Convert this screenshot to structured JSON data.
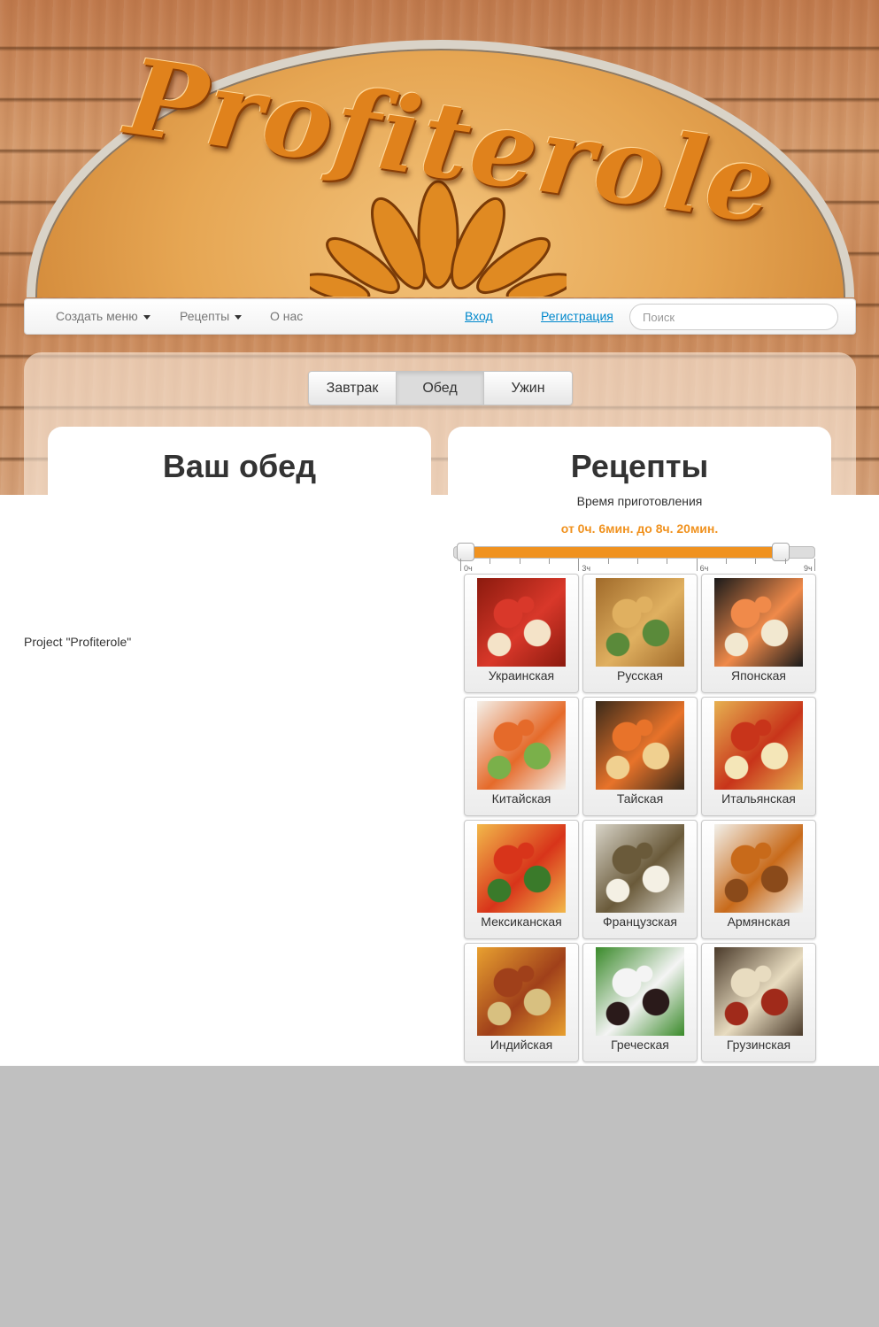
{
  "logo": {
    "text": "Profiterole"
  },
  "nav": {
    "create_menu": "Создать меню",
    "recipes": "Рецепты",
    "about": "О нас",
    "login": "Вход",
    "register": "Регистрация",
    "search_placeholder": "Поиск"
  },
  "meals": {
    "tabs": [
      {
        "label": "Завтрак",
        "active": false
      },
      {
        "label": "Обед",
        "active": true
      },
      {
        "label": "Ужин",
        "active": false
      }
    ]
  },
  "left_card": {
    "title": "Ваш обед"
  },
  "right_card": {
    "title": "Рецепты",
    "time_label": "Время приготовления",
    "time_range": "от 0ч. 6мин. до 8ч. 20мин.",
    "slider": {
      "min_hours": 0,
      "max_hours": 9,
      "low": 0.1,
      "high": 8.33,
      "tick_labels": [
        "0ч",
        "3ч",
        "6ч",
        "9ч"
      ]
    }
  },
  "cuisines": [
    {
      "label": "Украинская",
      "icon": "borscht-photo",
      "colors": [
        "#8b1a0e",
        "#d9382a",
        "#f4e3c8"
      ]
    },
    {
      "label": "Русская",
      "icon": "feast-photo",
      "colors": [
        "#a06a2a",
        "#e0b060",
        "#5a8a3a"
      ]
    },
    {
      "label": "Японская",
      "icon": "sushi-photo",
      "colors": [
        "#1a1a1a",
        "#f08a4a",
        "#f2e8d0"
      ]
    },
    {
      "label": "Китайская",
      "icon": "chinese-dish-photo",
      "colors": [
        "#f4efe8",
        "#e56a2a",
        "#7ab04a"
      ]
    },
    {
      "label": "Тайская",
      "icon": "thai-seafood-photo",
      "colors": [
        "#3a2a1a",
        "#e8732a",
        "#f0d090"
      ]
    },
    {
      "label": "Итальянская",
      "icon": "pizza-photo",
      "colors": [
        "#e6b050",
        "#c8341a",
        "#f4e6b8"
      ]
    },
    {
      "label": "Мексиканская",
      "icon": "nachos-photo",
      "colors": [
        "#f2b84a",
        "#d8341a",
        "#3a7a2a"
      ]
    },
    {
      "label": "Французская",
      "icon": "escargot-photo",
      "colors": [
        "#d8d4c8",
        "#6a5a3a",
        "#f4f0e4"
      ]
    },
    {
      "label": "Армянская",
      "icon": "soup-bowl-photo",
      "colors": [
        "#f2f0ea",
        "#c86a1a",
        "#8a4a1a"
      ]
    },
    {
      "label": "Индийская",
      "icon": "spices-photo",
      "colors": [
        "#e8a030",
        "#a0401a",
        "#d8c080"
      ]
    },
    {
      "label": "Греческая",
      "icon": "greek-salad-photo",
      "colors": [
        "#3a8a2a",
        "#f4f4f4",
        "#2a1a1a"
      ]
    },
    {
      "label": "Грузинская",
      "icon": "khinkali-photo",
      "colors": [
        "#4a3a2a",
        "#e8dcc0",
        "#a02a1a"
      ]
    }
  ],
  "footer": {
    "text": "Project \"Profiterole\""
  }
}
